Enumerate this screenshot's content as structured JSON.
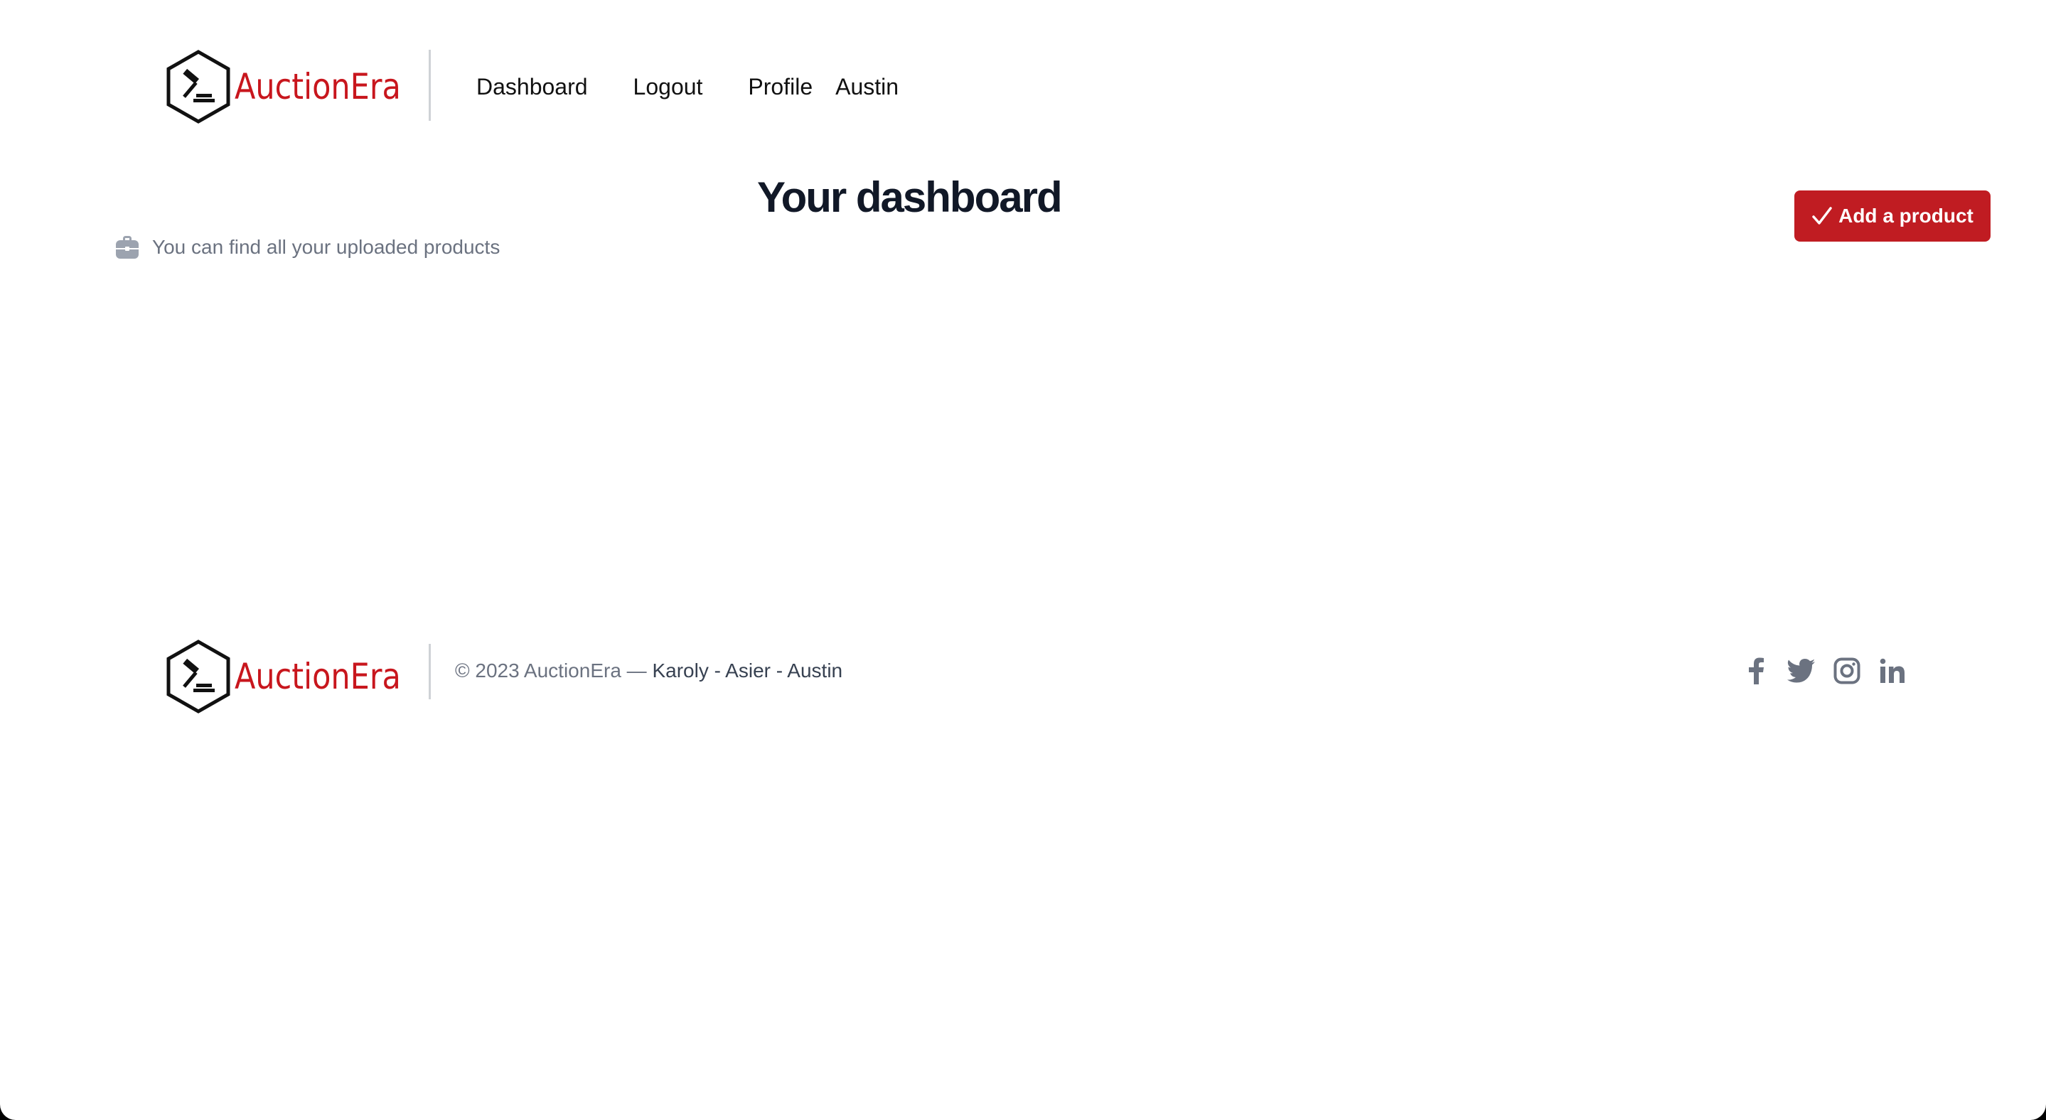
{
  "brand": {
    "name": "AuctionEra",
    "color": "#c8161d"
  },
  "nav": {
    "dashboard": "Dashboard",
    "logout": "Logout",
    "profile": "Profile",
    "username": "Austin"
  },
  "main": {
    "title": "Your dashboard",
    "subtitle": "You can find all your uploaded products",
    "subtitle_icon": "briefcase-icon",
    "add_button": "Add a product",
    "add_button_icon": "check-icon",
    "accent": "#c01c22"
  },
  "footer": {
    "copyright": "© 2023 AuctionEra —",
    "authors": "Karoly - Asier - Austin",
    "socials": [
      "facebook-icon",
      "twitter-icon",
      "instagram-icon",
      "linkedin-icon"
    ]
  }
}
